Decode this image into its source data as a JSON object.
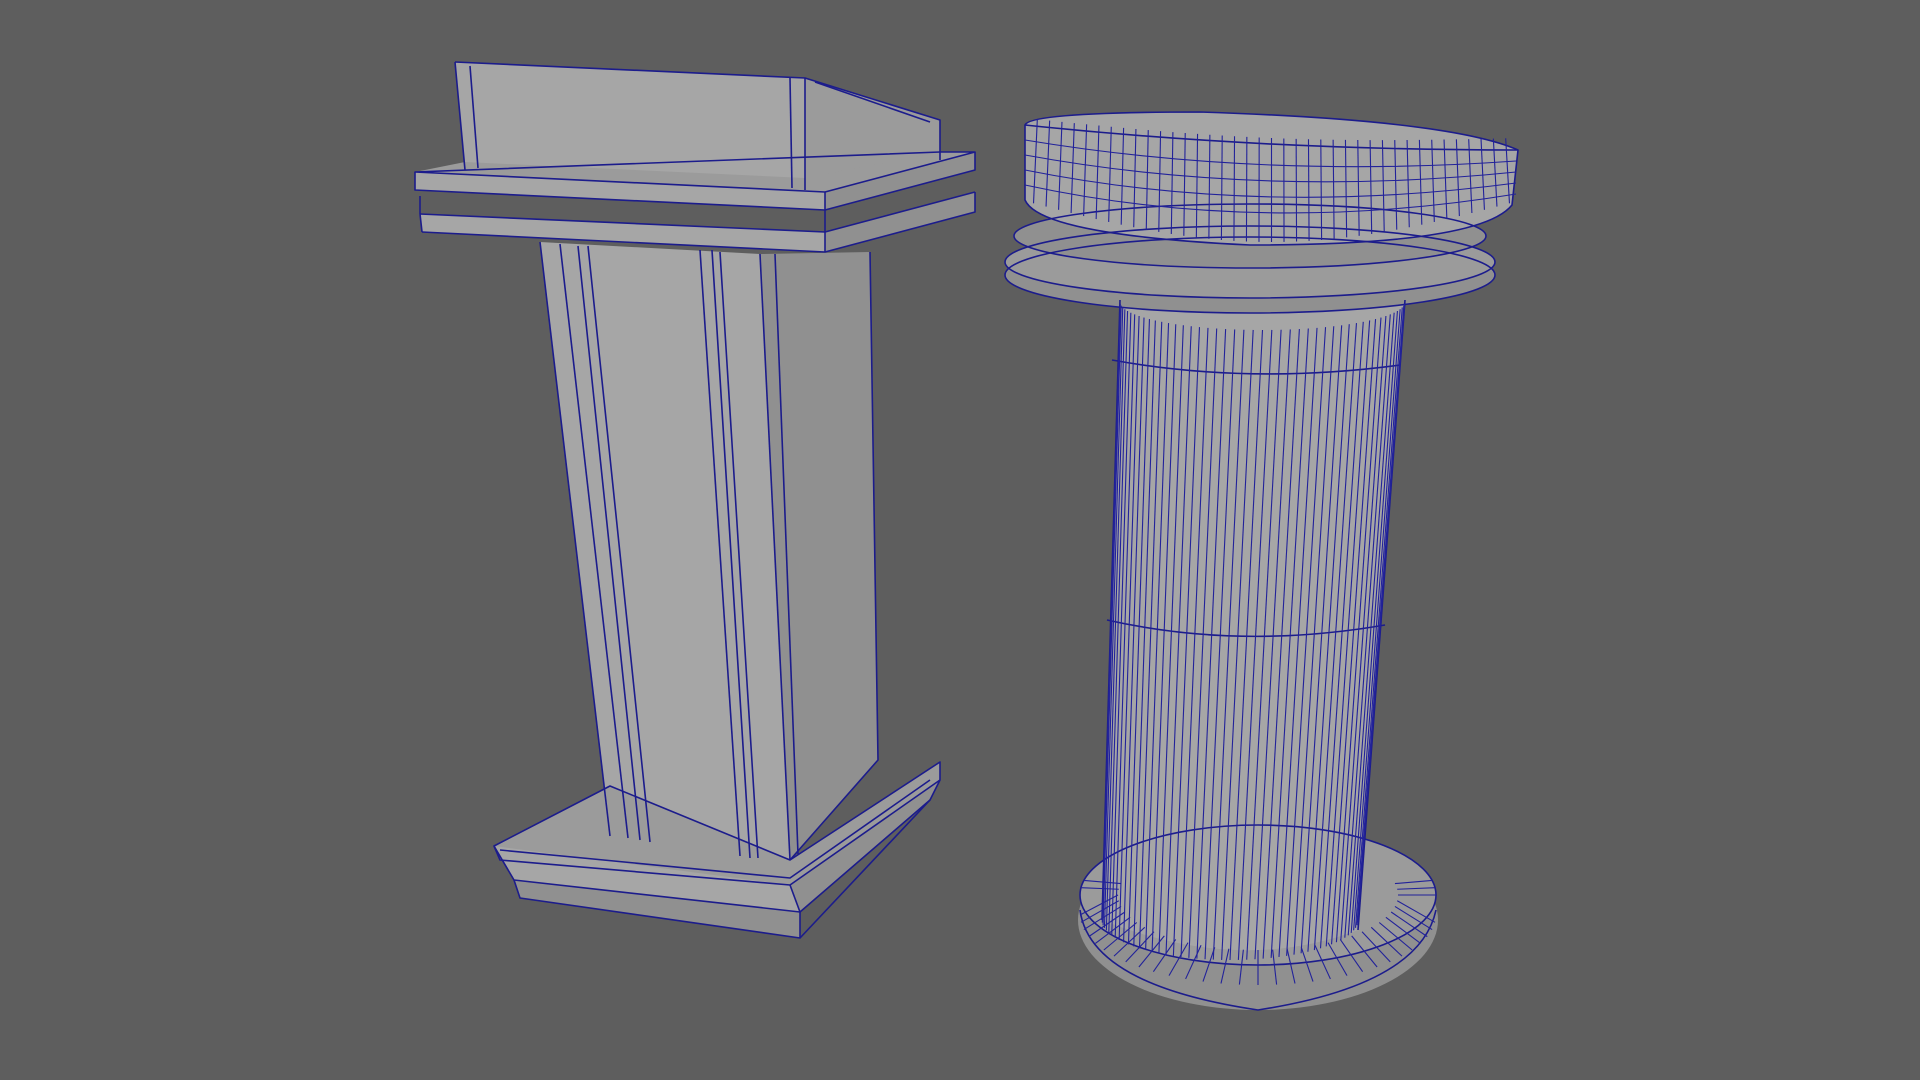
{
  "viewport": {
    "background": "#5e5e5e",
    "shading": "wireframe-on-shaded",
    "mesh_color": "#1c1c8c",
    "surface_color": "#9b9b9b"
  },
  "objects": [
    {
      "id": "lectern-box",
      "kind": "box lectern"
    },
    {
      "id": "lectern-column",
      "kind": "cylindrical lectern"
    }
  ]
}
